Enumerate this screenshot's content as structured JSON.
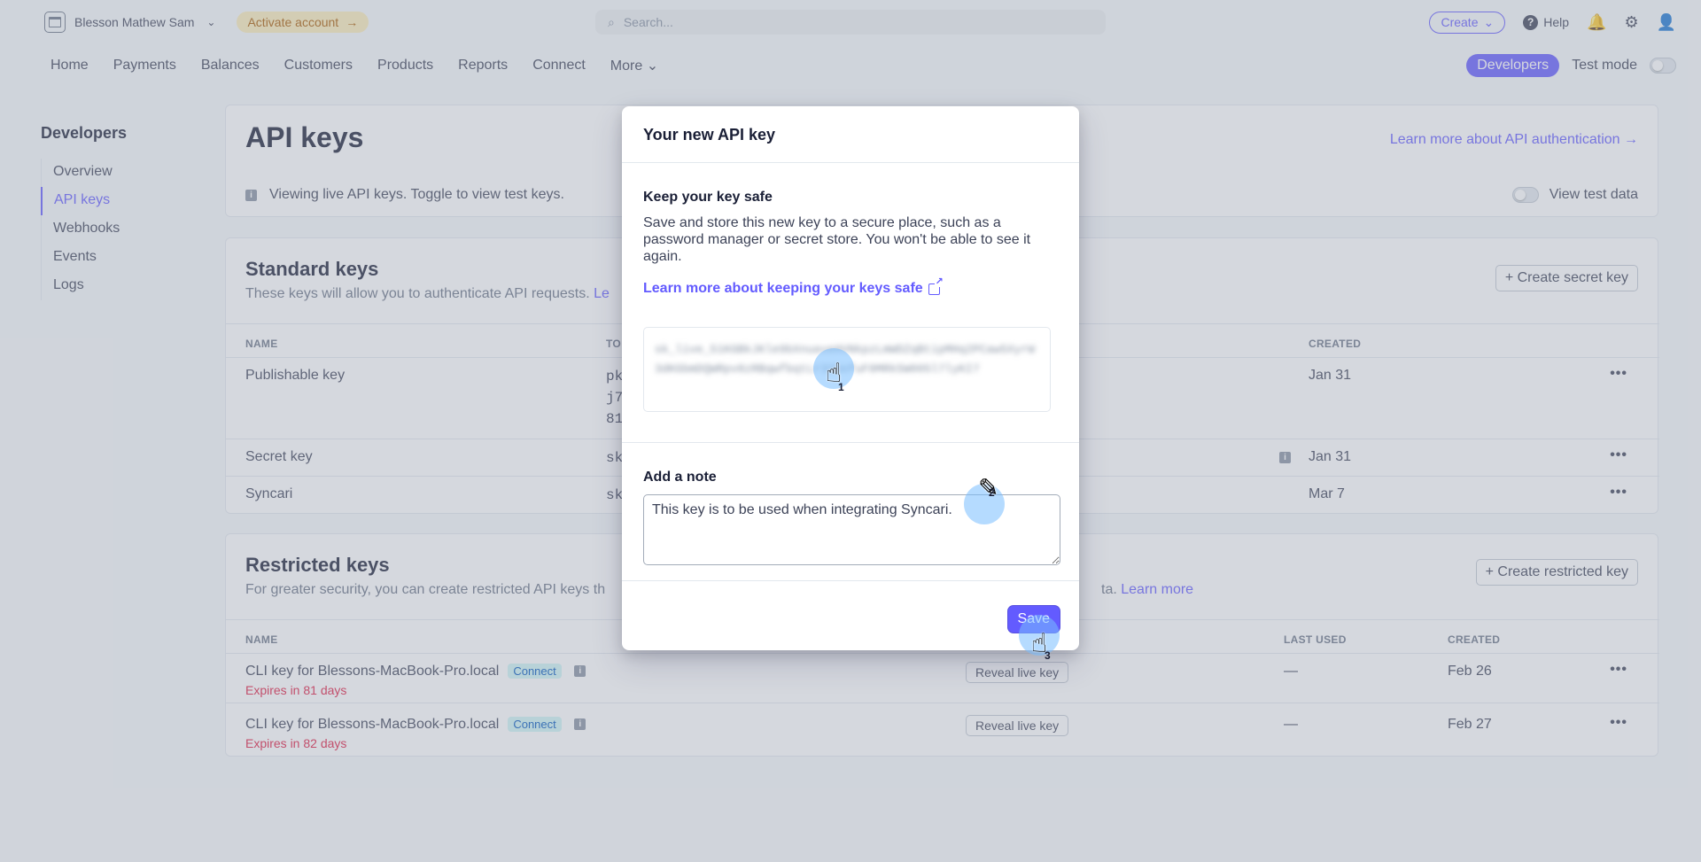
{
  "topbar": {
    "account_name": "Blesson Mathew Sam",
    "activate_label": "Activate account",
    "search_placeholder": "Search...",
    "create_label": "Create",
    "help_label": "Help"
  },
  "nav": {
    "items": [
      "Home",
      "Payments",
      "Balances",
      "Customers",
      "Products",
      "Reports",
      "Connect",
      "More"
    ],
    "developers_label": "Developers",
    "test_mode_label": "Test mode"
  },
  "sidebar": {
    "title": "Developers",
    "items": [
      "Overview",
      "API keys",
      "Webhooks",
      "Events",
      "Logs"
    ]
  },
  "page": {
    "title": "API keys",
    "learn_link": "Learn more about API authentication →",
    "info_text": "Viewing live API keys. Toggle to view test keys.",
    "view_test_label": "View test data"
  },
  "standard": {
    "title": "Standard keys",
    "desc": "These keys will allow you to authenticate API requests.",
    "desc_link": "Le",
    "create_btn": "Create secret key",
    "col_name": "NAME",
    "col_token": "TO",
    "col_created": "CREATED",
    "rows": [
      {
        "name": "Publishable key",
        "token": "pk\nj7\n81",
        "created": "Jan 31"
      },
      {
        "name": "Secret key",
        "token": "sk",
        "created": "Jan 31"
      },
      {
        "name": "Syncari",
        "token": "sk",
        "created": "Mar 7"
      }
    ]
  },
  "restricted": {
    "title": "Restricted keys",
    "desc": "For greater security, you can create restricted API keys th",
    "desc_tail": "ta.",
    "desc_link": "Learn more",
    "create_btn": "Create restricted key",
    "col_name": "NAME",
    "col_last_used": "LAST USED",
    "col_created": "CREATED",
    "rows": [
      {
        "name": "CLI key for Blessons-MacBook-Pro.local",
        "badge": "Connect",
        "expires": "Expires in 81 days",
        "reveal": "Reveal live key",
        "last_used": "—",
        "created": "Feb 26"
      },
      {
        "name": "CLI key for Blessons-MacBook-Pro.local",
        "badge": "Connect",
        "expires": "Expires in 82 days",
        "reveal": "Reveal live key",
        "last_used": "—",
        "created": "Feb 27"
      }
    ]
  },
  "modal": {
    "title": "Your new API key",
    "keep_safe_heading": "Keep your key safe",
    "keep_safe_text": "Save and store this new key to a secure place, such as a password manager or secret store. You won't be able to see it again.",
    "keep_safe_link": "Learn more about keeping your keys safe",
    "key_value": "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",
    "note_label": "Add a note",
    "note_value": "This key is to be used when integrating Syncari.",
    "save_label": "Save"
  },
  "steps": [
    "1",
    "2",
    "3"
  ],
  "colors": {
    "accent": "#635bff",
    "danger": "#df1b41",
    "warning_bg": "#fcedb9"
  }
}
